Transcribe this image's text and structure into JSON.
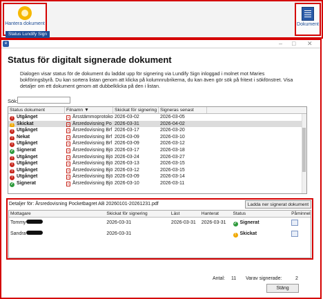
{
  "ribbon": {
    "manage_button": "Hantera dokument",
    "group_label": "Status Lundify Sign",
    "document_button": "Dokument"
  },
  "dialog": {
    "title": "Status för digitalt signerade dokument",
    "description": "Dialogen visar status för de dokument du laddat upp för signering via Lundify Sign inloggad i molnet mot Maries bokföringsbyrå. Du kan sortera listan genom att klicka på kolumnrubrikerna, du kan även gör sök på fritext i sökfönstret. Visa detaljer om ett dokument genom att dubbelklicka på den i listan.",
    "search_label": "Sök:",
    "search_value": "",
    "columns": [
      "Status dokument",
      "Filnamn",
      "Skickat för signering",
      "Signeras senast"
    ],
    "rows": [
      {
        "status": "Utgånget",
        "icon": "red",
        "file": "Årsstämmoprotokoll",
        "sent": "2026-03-02",
        "deadline": "2026-03-05"
      },
      {
        "status": "Skickat",
        "icon": "yellow",
        "file": "Årsredovisning Po",
        "sent": "2026-03-31",
        "deadline": "2026-04-02"
      },
      {
        "status": "Utgånget",
        "icon": "red",
        "file": "Årsredovisning Brf",
        "sent": "2026-03-17",
        "deadline": "2026-03-20"
      },
      {
        "status": "Nekat",
        "icon": "red",
        "file": "Årsredovisning Brf",
        "sent": "2026-03-09",
        "deadline": "2026-03-10"
      },
      {
        "status": "Utgånget",
        "icon": "red",
        "file": "Årsredovisning Brf",
        "sent": "2026-03-09",
        "deadline": "2026-03-12"
      },
      {
        "status": "Signerat",
        "icon": "green",
        "file": "Årsredovisning Bjö",
        "sent": "2026-03-17",
        "deadline": "2026-03-18"
      },
      {
        "status": "Utgånget",
        "icon": "red",
        "file": "Årsredovisning Bjö",
        "sent": "2026-03-24",
        "deadline": "2026-03-27"
      },
      {
        "status": "Utgånget",
        "icon": "red",
        "file": "Årsredovisning Bjö",
        "sent": "2026-03-13",
        "deadline": "2026-03-15"
      },
      {
        "status": "Utgånget",
        "icon": "red",
        "file": "Årsredovisning Bjö",
        "sent": "2026-03-12",
        "deadline": "2026-03-15"
      },
      {
        "status": "Utgånget",
        "icon": "red",
        "file": "Årsredovisning Bjö",
        "sent": "2026-03-09",
        "deadline": "2026-03-14"
      },
      {
        "status": "Signerat",
        "icon": "green",
        "file": "Årsredovisning Bjö",
        "sent": "2026-03-10",
        "deadline": "2026-03-11"
      }
    ],
    "detail": {
      "title": "Detaljer för: Årsredovisning Pocketbagret AB 20260101-20261231.pdf",
      "download_button": "Ladda ner signerat dokument",
      "columns": [
        "Mottagare",
        "Skickat för signering",
        "Läst",
        "Hanterat",
        "Status",
        "Påminnelse"
      ],
      "rows": [
        {
          "recipient": "Tommy",
          "sent": "2026-03-31",
          "read": "2026-03-31",
          "handled": "2026-03-31",
          "status": "Signerat",
          "icon": "green"
        },
        {
          "recipient": "Sandra",
          "sent": "2026-03-31",
          "read": "",
          "handled": "",
          "status": "Skickat",
          "icon": "yellow"
        }
      ]
    },
    "footer": {
      "count_label": "Antal:",
      "count_value": "11",
      "signed_label": "Varav signerade:",
      "signed_value": "2",
      "close_button": "Stäng"
    }
  }
}
